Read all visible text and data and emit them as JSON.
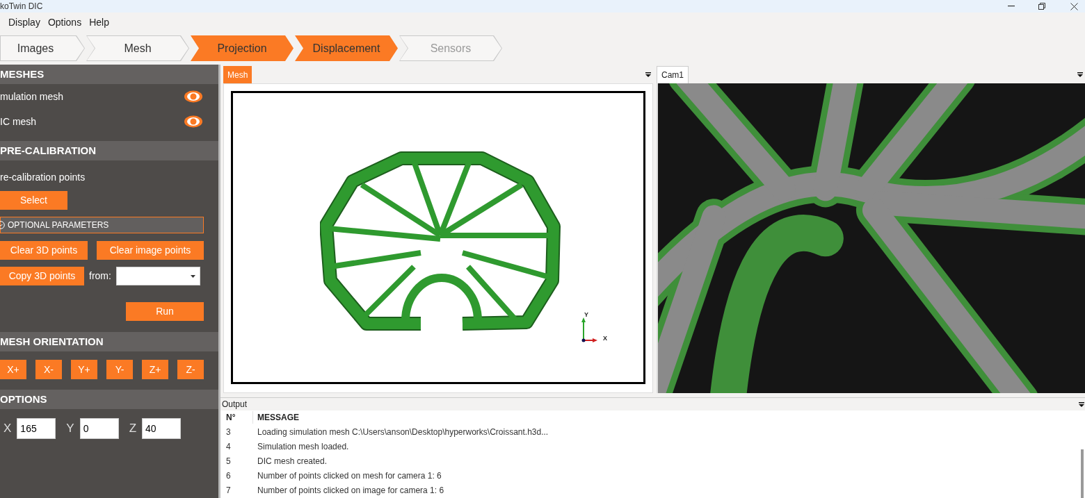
{
  "window": {
    "title": "koTwin DIC"
  },
  "menu": [
    "Display",
    "Options",
    "Help"
  ],
  "steps": [
    {
      "label": "Images",
      "active": false,
      "disabled": false
    },
    {
      "label": "Mesh",
      "active": false,
      "disabled": false
    },
    {
      "label": "Projection",
      "active": true,
      "disabled": false
    },
    {
      "label": "Displacement",
      "active": true,
      "disabled": false
    },
    {
      "label": "Sensors",
      "active": false,
      "disabled": true
    }
  ],
  "meshes": {
    "title": "MESHES",
    "items": [
      {
        "label": "mulation mesh",
        "visible": true
      },
      {
        "label": "IC mesh",
        "visible": true
      }
    ]
  },
  "pre_calibration": {
    "title": "PRE-CALIBRATION",
    "points_label": "re-calibration points",
    "select_button": "Select",
    "optional_parameters": {
      "label": "OPTIONAL PARAMETERS",
      "expanded": false
    },
    "clear_buttons": [
      "Clear 3D points",
      "Clear image points"
    ],
    "copy_button": "Copy 3D points",
    "from_label": "from:",
    "run_button": "Run"
  },
  "mesh_orientation": {
    "title": "MESH ORIENTATION",
    "buttons": [
      "X+",
      "X-",
      "Y+",
      "Y-",
      "Z+",
      "Z-"
    ]
  },
  "options": {
    "title": "OPTIONS",
    "fields": [
      {
        "label": "X",
        "value": "165"
      },
      {
        "label": "Y",
        "value": "0"
      },
      {
        "label": "Z",
        "value": "40"
      }
    ]
  },
  "views": [
    {
      "tab": "Mesh",
      "selected": true
    },
    {
      "tab": "Cam1",
      "selected": false
    }
  ],
  "axis": {
    "y": "Y",
    "x": "X"
  },
  "output": {
    "title": "Output",
    "columns": [
      "N°",
      "MESSAGE"
    ],
    "rows": [
      {
        "n": "3",
        "message": "Loading simulation mesh C:\\Users\\anson\\Desktop\\hyperworks\\Croissant.h3d..."
      },
      {
        "n": "4",
        "message": "Simulation mesh loaded."
      },
      {
        "n": "5",
        "message": "DIC mesh created."
      },
      {
        "n": "6",
        "message": "Number of points clicked on mesh for camera 1: 6"
      },
      {
        "n": "7",
        "message": "Number of points clicked on image for camera 1: 6"
      }
    ]
  }
}
